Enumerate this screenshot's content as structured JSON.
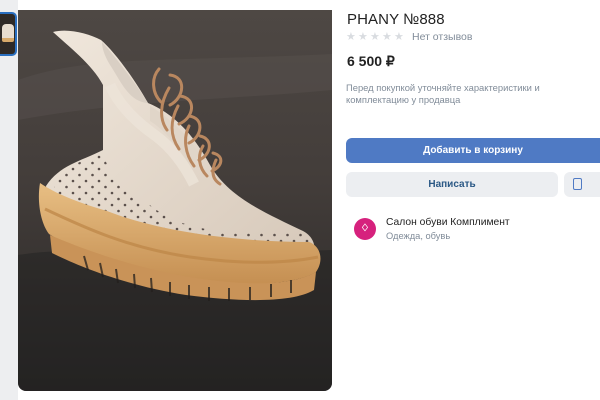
{
  "product": {
    "title": "PHANY №888",
    "rating_stars": 0,
    "reviews_label": "Нет отзывов",
    "price": "6 500 ₽",
    "notice": "Перед покупкой уточняйте характеристики и комплектацию у продавца"
  },
  "actions": {
    "add_to_cart_label": "Добавить в корзину",
    "write_label": "Написать"
  },
  "seller": {
    "name": "Салон обуви Комплимент",
    "category": "Одежда, обувь"
  },
  "gallery": {
    "photos_count": 1
  },
  "icons": {
    "thumbnail": "shoe-thumbnail-icon",
    "star": "star-icon",
    "bookmark": "bookmark-icon",
    "avatar": "seller-logo-icon"
  },
  "colors": {
    "primary_button": "#4f7ac4",
    "secondary_button": "#eceef1",
    "seller_logo": "#d6217d",
    "muted_text": "#818c99",
    "star_empty": "#d9dce0",
    "thumbnail_border": "#2a6fc0"
  }
}
